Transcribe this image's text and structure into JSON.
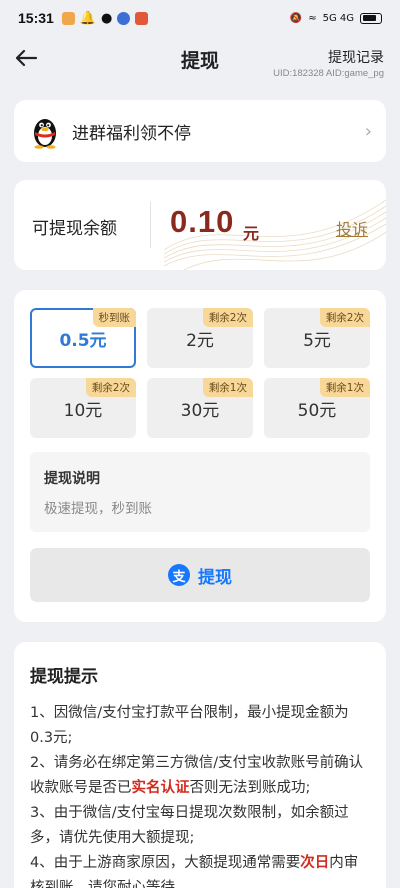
{
  "status_bar": {
    "time": "15:31",
    "right_text": "5G 4G"
  },
  "header": {
    "title": "提现",
    "record_link": "提现记录",
    "uid": "UID:182328 AID:game_pg"
  },
  "group": {
    "label": "进群福利领不停"
  },
  "balance": {
    "label": "可提现余额",
    "amount": "0.10",
    "unit": "元",
    "complain": "投诉"
  },
  "options": [
    {
      "amount": "0.5元",
      "tag": "秒到账",
      "selected": true
    },
    {
      "amount": "2元",
      "tag": "剩余2次",
      "selected": false
    },
    {
      "amount": "5元",
      "tag": "剩余2次",
      "selected": false
    },
    {
      "amount": "10元",
      "tag": "剩余2次",
      "selected": false
    },
    {
      "amount": "30元",
      "tag": "剩余1次",
      "selected": false
    },
    {
      "amount": "50元",
      "tag": "剩余1次",
      "selected": false
    }
  ],
  "description": {
    "title": "提现说明",
    "text": "极速提现，秒到账"
  },
  "withdraw_button": {
    "icon": "支",
    "label": "提现"
  },
  "tips": {
    "title": "提现提示",
    "items": [
      {
        "pre": "1、因微信/支付宝打款平台限制，最小提现金额为0.3元;",
        "red": "",
        "post": ""
      },
      {
        "pre": "2、请务必在绑定第三方微信/支付宝收款账号前确认收款账号是否已",
        "red": "实名认证",
        "post": "否则无法到账成功;"
      },
      {
        "pre": "3、由于微信/支付宝每日提现次数限制，如余额过多，请优先使用大额提现;",
        "red": "",
        "post": ""
      },
      {
        "pre": "4、由于上游商家原因，大额提现通常需要",
        "red": "次日",
        "post": "内审核到账，请您耐心等待。"
      }
    ]
  },
  "colors": {
    "accent_blue": "#2f7ad6",
    "alipay_blue": "#1677ff",
    "amount_red": "#8a2a1e",
    "tag_gold": "#f7d898",
    "highlight_red": "#d22b1e"
  }
}
